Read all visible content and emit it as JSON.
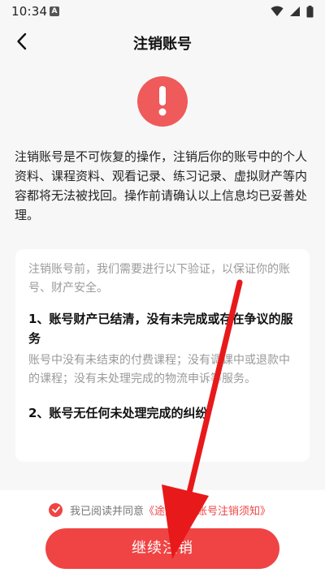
{
  "status_bar": {
    "time": "10:34",
    "notification_badge": "A"
  },
  "header": {
    "title": "注销账号"
  },
  "intro": {
    "text": "注销账号是不可恢复的操作，注销后你的账号中的个人资料、课程资料、观看记录、练习记录、虚拟财产等内容都将无法被找回。操作前请确认以上信息均已妥善处理。"
  },
  "card": {
    "lead": "注销账号前，我们需要进行以下验证，以保证你的账号、财产安全。",
    "items": [
      {
        "heading": "1、账号财产已结清，没有未完成或存在争议的服务",
        "description": "账号中没有未结束的付费课程；没有调课中或退款中的课程；没有未处理完成的物流申诉等服务。"
      },
      {
        "heading": "2、账号无任何未处理完成的纠纷"
      }
    ]
  },
  "agreement": {
    "prefix": "我已阅读并同意",
    "link": "《途途课堂账号注销须知》",
    "checked": true
  },
  "actions": {
    "submit_label": "继续注销"
  },
  "colors": {
    "accent": "#ef4444",
    "warn_icon": "#ef5a5a",
    "annotation_arrow": "#e8191a"
  },
  "icons": {
    "back": "chevron-left-icon",
    "warning": "exclamation-icon",
    "check": "check-icon"
  }
}
